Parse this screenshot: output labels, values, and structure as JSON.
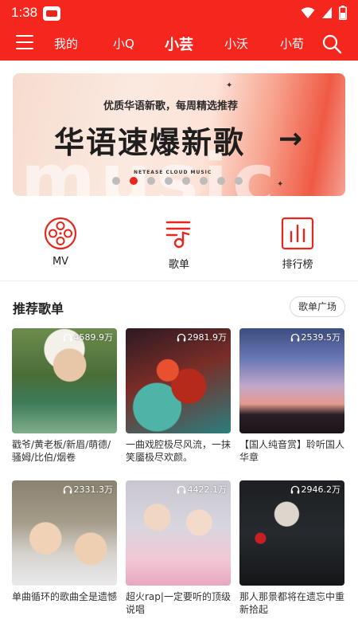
{
  "status_bar": {
    "time": "1:38"
  },
  "nav": {
    "tabs": [
      {
        "label": "我的"
      },
      {
        "label": "小Q"
      },
      {
        "label": "小芸",
        "active": true
      },
      {
        "label": "小沃"
      },
      {
        "label": "小荀"
      }
    ]
  },
  "banner": {
    "subtitle": "优质华语新歌，每周精选推荐",
    "title": "华语速爆新歌",
    "arrow": "→",
    "brand": "NETEASE CLOUD MUSIC",
    "bg_text": "music",
    "dot_count": 8,
    "active_dot": 1
  },
  "quick_entries": [
    {
      "label": "MV",
      "icon": "film-reel-icon"
    },
    {
      "label": "歌单",
      "icon": "playlist-icon"
    },
    {
      "label": "排行榜",
      "icon": "chart-icon"
    }
  ],
  "section": {
    "title": "推荐歌单",
    "button": "歌单广场"
  },
  "playlists": [
    {
      "plays": "4589.9万",
      "title": "戳爷/黄老板/新眉/萌德/骚姆/比伯/烟卷"
    },
    {
      "plays": "2981.9万",
      "title": "一曲戏腔极尽风流，一抹笑靥极尽欢颜。"
    },
    {
      "plays": "2539.5万",
      "title": "【国人纯音赏】聆听国人华章"
    },
    {
      "plays": "2331.3万",
      "title": "单曲循环的歌曲全是遗憾"
    },
    {
      "plays": "4422.1万",
      "title": "超火rap|一定要听的顶级说唱"
    },
    {
      "plays": "2946.2万",
      "title": "那人那景都将在遗忘中重新拾起"
    }
  ],
  "colors": {
    "brand": "#f5261d",
    "accent": "#e8261d"
  }
}
